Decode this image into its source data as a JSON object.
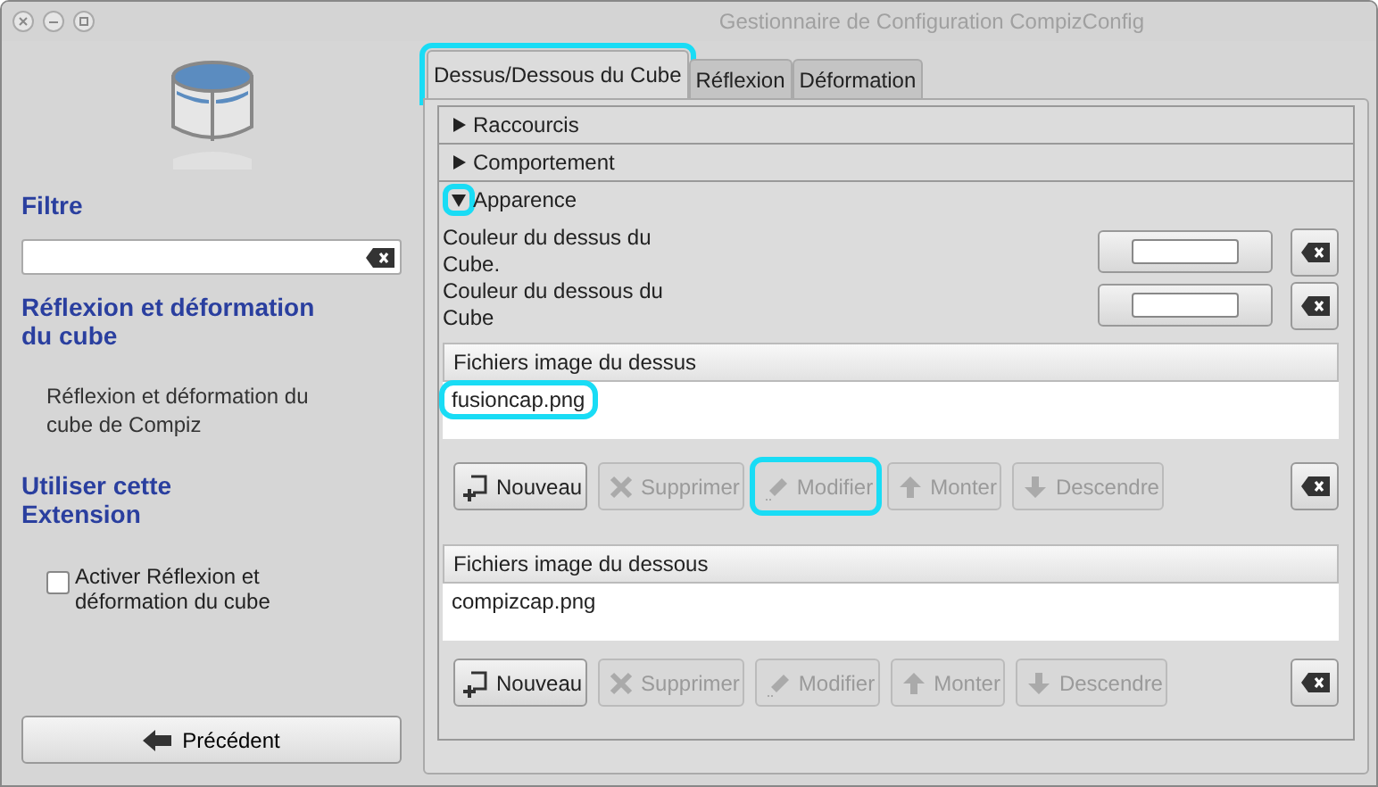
{
  "window": {
    "title": "Gestionnaire de Configuration CompizConfig"
  },
  "sidebar": {
    "filter_heading": "Filtre",
    "plugin_title": "Réflexion et déformation du cube",
    "description": "Réflexion et déformation du cube de Compiz",
    "use_heading": "Utiliser cette Extension",
    "enable": {
      "label": "Activer Réflexion et déformation du cube",
      "checked": false
    },
    "back_button": "Précédent"
  },
  "tabs": [
    {
      "label": "Dessus/Dessous du Cube",
      "selected": true,
      "highlighted": true
    },
    {
      "label": "Réflexion",
      "selected": false,
      "highlighted": false
    },
    {
      "label": "Déformation",
      "selected": false,
      "highlighted": false
    }
  ],
  "sections": [
    {
      "title": "Raccourcis",
      "expanded": false,
      "highlighted": false
    },
    {
      "title": "Comportement",
      "expanded": false,
      "highlighted": false
    },
    {
      "title": "Apparence",
      "expanded": true,
      "highlighted": true
    }
  ],
  "color_settings": [
    {
      "label": "Couleur du dessus du Cube.",
      "color": "#ffffff"
    },
    {
      "label": "Couleur du dessous du Cube",
      "color": "#ffffff"
    }
  ],
  "file_lists": [
    {
      "header": "Fichiers image du dessus",
      "items": [
        {
          "text": "fusioncap.png",
          "highlighted": true
        }
      ],
      "buttons": [
        {
          "kind": "add",
          "label": "Nouveau",
          "disabled": false,
          "highlighted": false
        },
        {
          "kind": "remove",
          "label": "Supprimer",
          "disabled": true,
          "highlighted": false
        },
        {
          "kind": "edit",
          "label": "Modifier",
          "disabled": true,
          "highlighted": true
        },
        {
          "kind": "up",
          "label": "Monter",
          "disabled": true,
          "highlighted": false
        },
        {
          "kind": "down",
          "label": "Descendre",
          "disabled": true,
          "highlighted": false
        }
      ]
    },
    {
      "header": "Fichiers image du dessous",
      "items": [
        {
          "text": "compizcap.png",
          "highlighted": false
        }
      ],
      "buttons": [
        {
          "kind": "add",
          "label": "Nouveau",
          "disabled": false,
          "highlighted": false
        },
        {
          "kind": "remove",
          "label": "Supprimer",
          "disabled": true,
          "highlighted": false
        },
        {
          "kind": "edit",
          "label": "Modifier",
          "disabled": true,
          "highlighted": false
        },
        {
          "kind": "up",
          "label": "Monter",
          "disabled": true,
          "highlighted": false
        },
        {
          "kind": "down",
          "label": "Descendre",
          "disabled": true,
          "highlighted": false
        }
      ]
    }
  ]
}
